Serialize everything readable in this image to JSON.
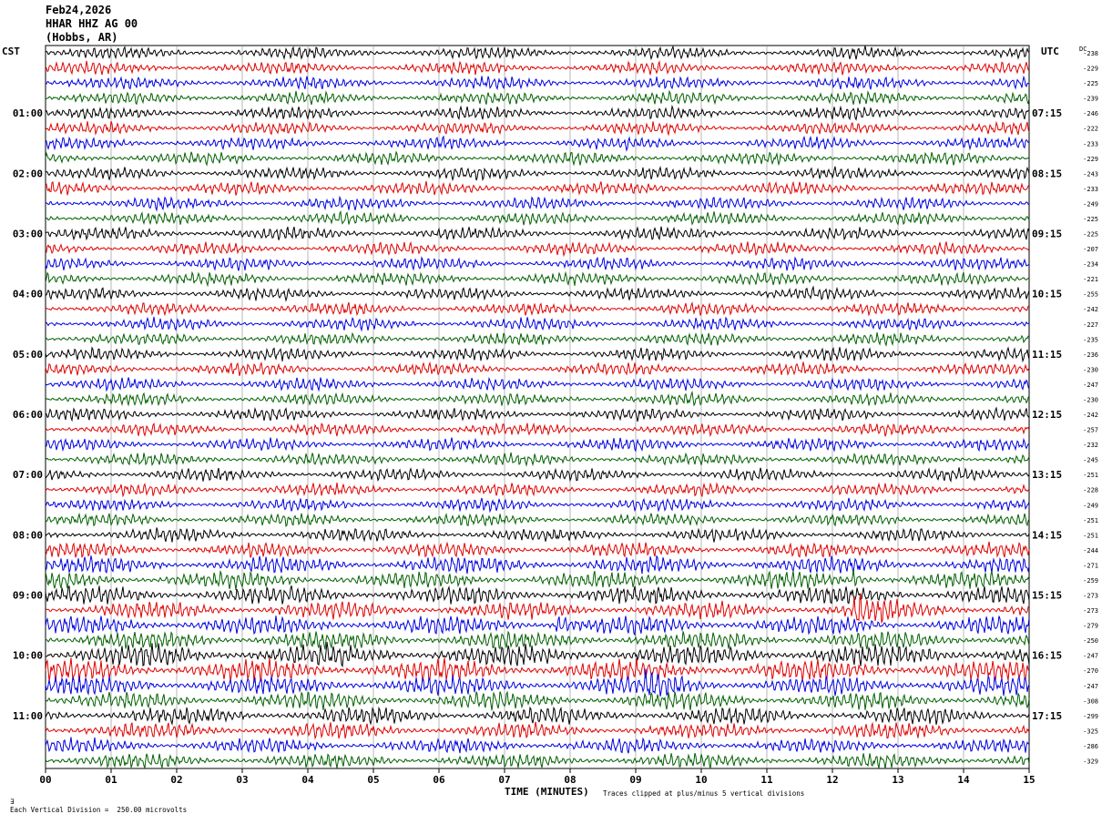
{
  "header": {
    "date": "Feb24,2026",
    "channel": "HHAR HHZ AG 00",
    "location": "(Hobbs, AR)"
  },
  "left_tz": "CST",
  "right_tz": "UTC",
  "dc_header": "DC",
  "footer": {
    "scale_note": "Each Vertical Division =  250.00 microvolts",
    "xlabel": "TIME (MINUTES)",
    "clip_note": "Traces clipped at plus/minus 5 vertical divisions"
  },
  "colors": {
    "trace_cycle": [
      "#000000",
      "#e00000",
      "#0000e0",
      "#006000"
    ],
    "grid": "#888888"
  },
  "chart_data": {
    "type": "line",
    "title": "HHAR HHZ AG 00",
    "xlabel": "TIME (MINUTES)",
    "x_ticks": [
      "00",
      "01",
      "02",
      "03",
      "04",
      "05",
      "06",
      "07",
      "08",
      "09",
      "10",
      "11",
      "12",
      "13",
      "14",
      "15"
    ],
    "xlim": [
      0,
      15
    ],
    "left_hour_labels": [
      "01:00",
      "02:00",
      "03:00",
      "04:00",
      "05:00",
      "06:00",
      "07:00",
      "08:00",
      "09:00",
      "10:00",
      "11:00"
    ],
    "right_hour_labels": [
      "07:15",
      "08:15",
      "09:15",
      "10:15",
      "11:15",
      "12:15",
      "13:15",
      "14:15",
      "15:15",
      "16:15",
      "17:15"
    ],
    "dc_offsets": [
      -238,
      -229,
      -225,
      -239,
      -246,
      -222,
      -233,
      -229,
      -243,
      -233,
      -249,
      -225,
      -225,
      -207,
      -234,
      -221,
      -255,
      -242,
      -227,
      -235,
      -236,
      -230,
      -247,
      -230,
      -242,
      -257,
      -232,
      -245,
      -251,
      -228,
      -249,
      -251,
      -251,
      -244,
      -271,
      -259,
      -273,
      -273,
      -279,
      -250,
      -247,
      -270,
      -247,
      -308,
      -299,
      -325,
      -286,
      -329
    ],
    "trace_amplitude": [
      0.5,
      0.5,
      0.5,
      0.5,
      0.5,
      0.5,
      0.5,
      0.5,
      0.5,
      0.5,
      0.5,
      0.5,
      0.5,
      0.5,
      0.5,
      0.5,
      0.5,
      0.5,
      0.5,
      0.5,
      0.5,
      0.5,
      0.5,
      0.5,
      0.5,
      0.5,
      0.5,
      0.5,
      0.5,
      0.5,
      0.5,
      0.5,
      0.55,
      0.6,
      0.7,
      0.7,
      0.75,
      0.7,
      0.75,
      0.75,
      0.9,
      0.9,
      0.8,
      0.7,
      0.7,
      0.65,
      0.6,
      0.6
    ],
    "events": [
      {
        "trace": 34,
        "minute": 10.8,
        "duration": 0.4,
        "gain": 1.8
      },
      {
        "trace": 35,
        "minute": 12.35,
        "duration": 0.3,
        "gain": 4.0
      },
      {
        "trace": 37,
        "minute": 12.38,
        "duration": 0.8,
        "gain": 3.0
      },
      {
        "trace": 38,
        "minute": 7.8,
        "duration": 0.5,
        "gain": 3.5
      },
      {
        "trace": 42,
        "minute": 9.2,
        "duration": 1.5,
        "gain": 2.0
      }
    ]
  }
}
